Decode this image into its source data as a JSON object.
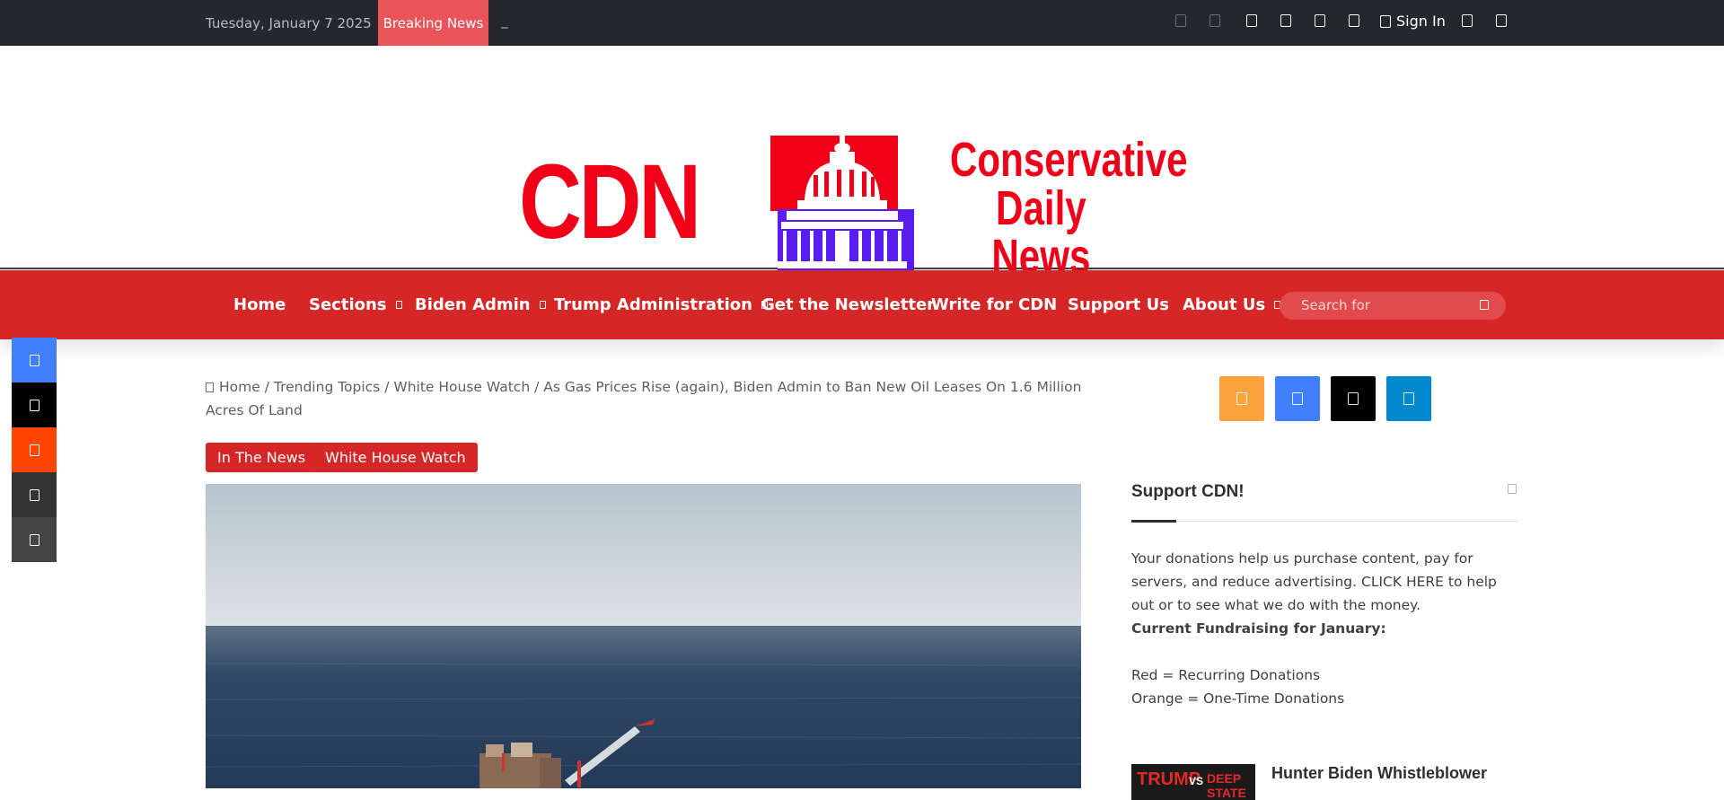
{
  "topbar": {
    "date": "Tuesday, January 7 2025",
    "breaking_label": "Breaking News",
    "ticker_text": "_",
    "sign_in": "Sign In"
  },
  "logo": {
    "short": "CDN",
    "name_lines": [
      "Conservative",
      "Daily",
      "News"
    ],
    "brand_red": "#f00018",
    "brand_blue": "#5b1cf0"
  },
  "nav": {
    "items": [
      {
        "label": "Home",
        "has_submenu": false
      },
      {
        "label": "Sections",
        "has_submenu": true
      },
      {
        "label": "Biden Admin",
        "has_submenu": true
      },
      {
        "label": "Trump Administration",
        "has_submenu": true
      },
      {
        "label": "Get the Newsletter",
        "has_submenu": false
      },
      {
        "label": "Write for CDN",
        "has_submenu": false
      },
      {
        "label": "Support Us",
        "has_submenu": false
      },
      {
        "label": "About Us",
        "has_submenu": true
      }
    ],
    "search_placeholder": "Search for",
    "background": "#d62728"
  },
  "share_bar": {
    "buttons": [
      {
        "name": "facebook-share",
        "color": "#4080ff"
      },
      {
        "name": "x-share",
        "color": "#000000"
      },
      {
        "name": "reddit-share",
        "color": "#ff4500"
      },
      {
        "name": "email-share",
        "color": "#333333"
      },
      {
        "name": "print-share",
        "color": "#444444"
      }
    ]
  },
  "breadcrumb": {
    "home": "Home",
    "sep": "/",
    "items": [
      "Trending Topics",
      "White House Watch"
    ],
    "current": "As Gas Prices Rise (again), Biden Admin to Ban New Oil Leases On 1.6 Million Acres Of Land"
  },
  "tags": [
    "In The News",
    "White House Watch"
  ],
  "sidebar": {
    "social": [
      {
        "name": "rss-button",
        "color": "#faa33d"
      },
      {
        "name": "facebook-button",
        "color": "#4080ff"
      },
      {
        "name": "x-button",
        "color": "#000000"
      },
      {
        "name": "telegram-button",
        "color": "#0088cc"
      }
    ],
    "widget_title": "Support CDN!",
    "widget_text": "Your donations help us purchase content, pay for servers, and reduce advertising. CLICK HERE to help out or to see what we do with the money.",
    "fundraising_label": "Current Fundraising for January:",
    "legend_red": "Red = Recurring Donations",
    "legend_orange": "Orange = One-Time Donations",
    "post_thumb_words": [
      "TRUMP",
      "VS",
      "DEEP STATE"
    ],
    "post_title": "Hunter Biden Whistleblower"
  }
}
